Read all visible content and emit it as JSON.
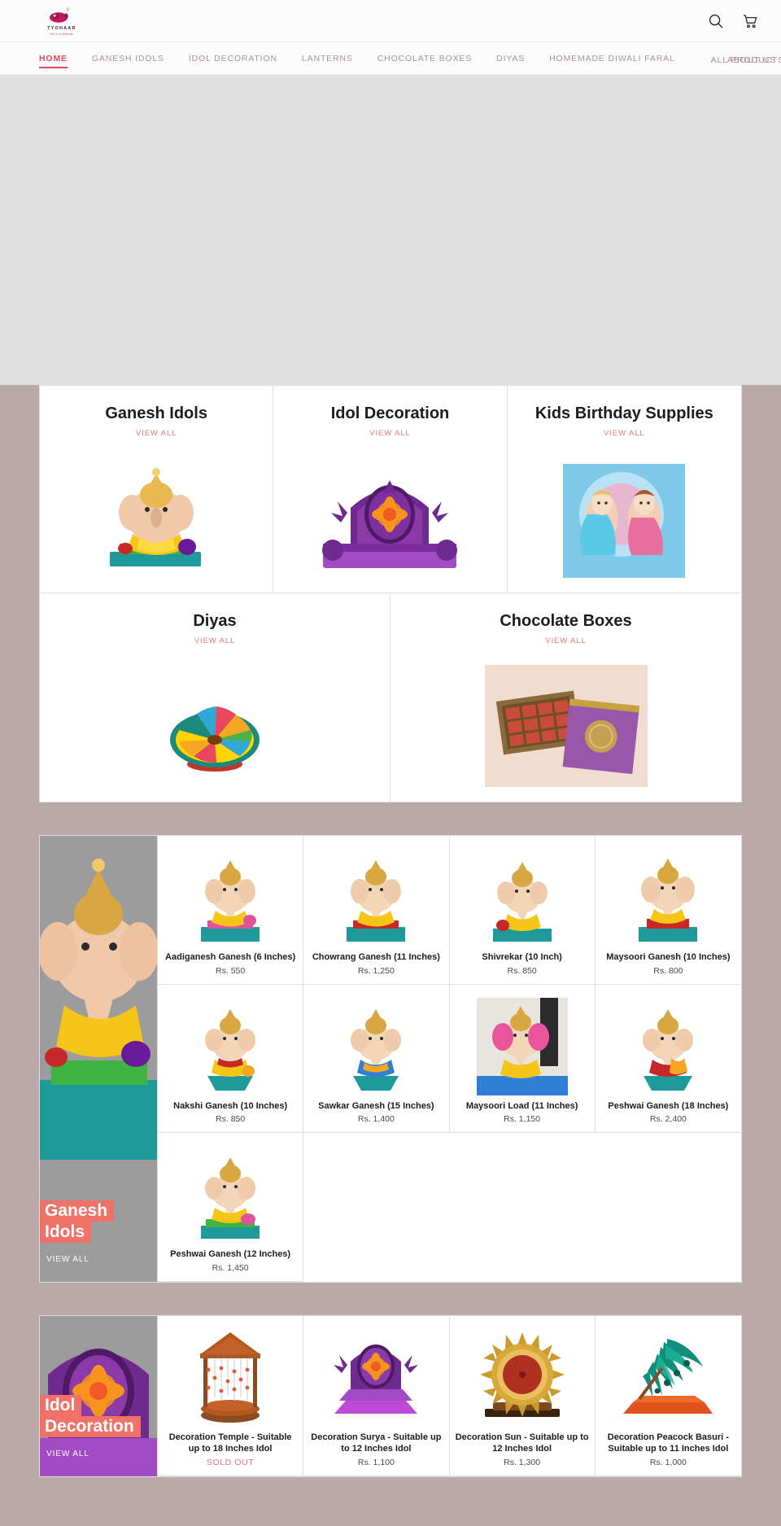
{
  "brand": {
    "name": "TYOHAAR",
    "tagline": "Let's celebrate",
    "logo_icon": "diya-lamp-icon",
    "accent": "#e14b57",
    "highlight": "#f07167"
  },
  "header": {
    "search_icon": "search-icon",
    "cart_icon": "shopping-cart-icon"
  },
  "nav": {
    "items": [
      {
        "label": "HOME",
        "active": true
      },
      {
        "label": "GANESH IDOLS",
        "active": false
      },
      {
        "label": "IDOL DECORATION",
        "active": false
      },
      {
        "label": "LANTERNS",
        "active": false
      },
      {
        "label": "CHOCOLATE BOXES",
        "active": false
      },
      {
        "label": "DIYAS",
        "active": false
      },
      {
        "label": "HOMEMADE DIWALI FARAL",
        "active": false
      }
    ],
    "overlap_a": "ABOUT US",
    "overlap_b": "ALL PRODUCTS"
  },
  "categories": {
    "view_all_label": "VIEW ALL",
    "row1": [
      {
        "title": "Ganesh Idols",
        "art": "ganesh-idol-art"
      },
      {
        "title": "Idol Decoration",
        "art": "idol-decoration-art"
      },
      {
        "title": "Kids Birthday Supplies",
        "art": "kids-birthday-art"
      }
    ],
    "row2": [
      {
        "title": "Diyas",
        "art": "diya-art"
      },
      {
        "title": "Chocolate Boxes",
        "art": "chocolate-box-art"
      }
    ]
  },
  "collections": [
    {
      "tile_title": "Ganesh Idols",
      "tile_view_all": "VIEW ALL",
      "products": [
        {
          "name": "Aadiganesh Ganesh (6 Inches)",
          "price": "Rs. 550",
          "sold_out": false
        },
        {
          "name": "Chowrang Ganesh (11 Inches)",
          "price": "Rs. 1,250",
          "sold_out": false
        },
        {
          "name": "Shivrekar (10 Inch)",
          "price": "Rs. 850",
          "sold_out": false
        },
        {
          "name": "Maysoori Ganesh (10 Inches)",
          "price": "Rs. 800",
          "sold_out": false
        },
        {
          "name": "Nakshi Ganesh (10 Inches)",
          "price": "Rs. 850",
          "sold_out": false
        },
        {
          "name": "Sawkar Ganesh (15 Inches)",
          "price": "Rs. 1,400",
          "sold_out": false
        },
        {
          "name": "Maysoori Load (11 Inches)",
          "price": "Rs. 1,150",
          "sold_out": false
        },
        {
          "name": "Peshwai Ganesh (18 Inches)",
          "price": "Rs. 2,400",
          "sold_out": false
        },
        {
          "name": "Peshwai Ganesh (12 Inches)",
          "price": "Rs. 1,450",
          "sold_out": false
        }
      ]
    },
    {
      "tile_title": "Idol Decoration",
      "tile_view_all": "VIEW ALL",
      "products": [
        {
          "name": "Decoration Temple - Suitable up to 18 Inches Idol",
          "price": "SOLD OUT",
          "sold_out": true
        },
        {
          "name": "Decoration Surya - Suitable up to 12 Inches Idol",
          "price": "Rs. 1,100",
          "sold_out": false
        },
        {
          "name": "Decoration Sun - Suitable up to 12 Inches Idol",
          "price": "Rs. 1,300",
          "sold_out": false
        },
        {
          "name": "Decoration Peacock Basuri - Suitable up to 11 Inches Idol",
          "price": "Rs. 1,000",
          "sold_out": false
        }
      ]
    }
  ]
}
